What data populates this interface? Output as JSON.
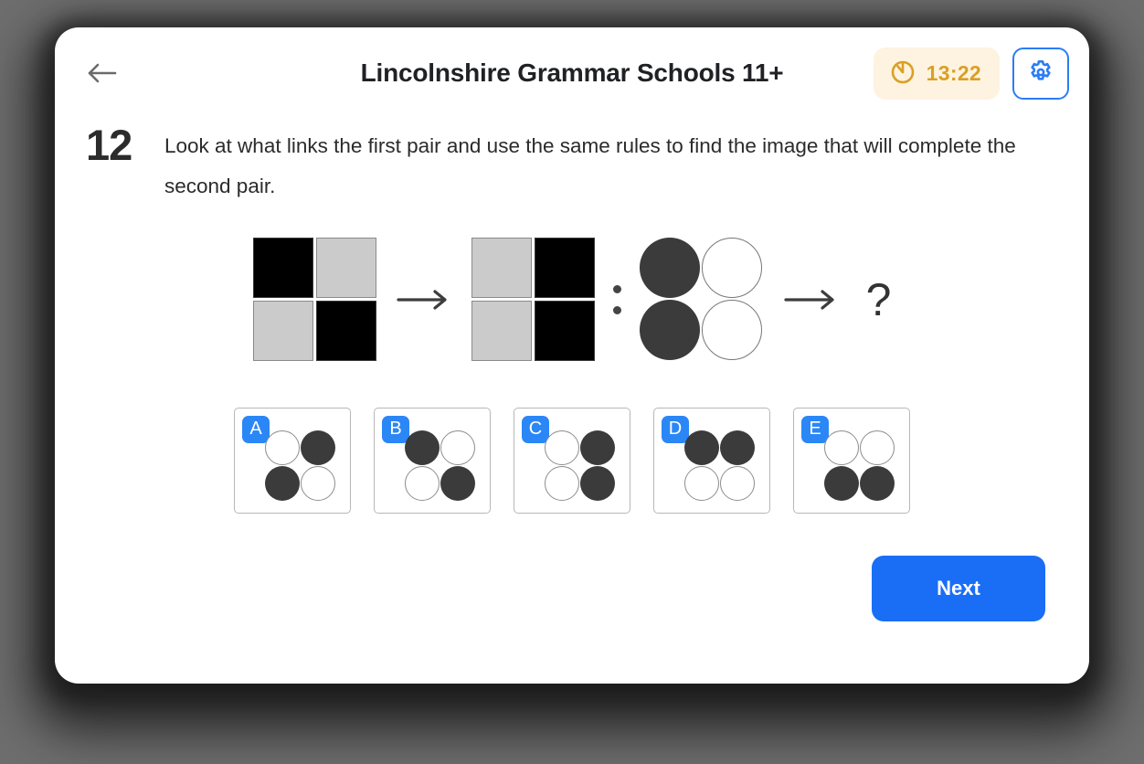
{
  "header": {
    "back_icon": "arrow-left-icon",
    "title": "Lincolnshire Grammar Schools 11+",
    "timer": {
      "icon": "stopwatch-icon",
      "value": "13:22",
      "bg": "#fdf3e0",
      "color": "#d9a024"
    },
    "settings": {
      "icon": "gear-icon",
      "border_color": "#2b7cf6"
    }
  },
  "question": {
    "number": "12",
    "text": "Look at what links the first pair and use the same rules to find the image that will complete the second pair."
  },
  "figure": {
    "first_pair": {
      "left": {
        "type": "squares",
        "cells": [
          "black",
          "gray",
          "gray",
          "black"
        ]
      },
      "arrow": "right-arrow-icon",
      "right": {
        "type": "squares",
        "cells": [
          "gray",
          "black",
          "gray",
          "black"
        ]
      }
    },
    "separator": "colon",
    "second_pair": {
      "left": {
        "type": "circles",
        "cells": [
          "dark",
          "light",
          "dark",
          "light"
        ]
      },
      "arrow": "right-arrow-icon",
      "right": {
        "type": "unknown",
        "glyph": "?"
      }
    }
  },
  "options": [
    {
      "label": "A",
      "cells": [
        "light",
        "dark",
        "dark",
        "light"
      ]
    },
    {
      "label": "B",
      "cells": [
        "dark",
        "light",
        "light",
        "dark"
      ]
    },
    {
      "label": "C",
      "cells": [
        "light",
        "dark",
        "light",
        "dark"
      ]
    },
    {
      "label": "D",
      "cells": [
        "dark",
        "dark",
        "light",
        "light"
      ]
    },
    {
      "label": "E",
      "cells": [
        "light",
        "light",
        "dark",
        "dark"
      ]
    }
  ],
  "footer": {
    "next_label": "Next",
    "next_color": "#1a6ef5"
  },
  "colors": {
    "page_bg": "#6e6e6e",
    "card_bg": "#ffffff",
    "accent_blue": "#2b87f6",
    "square_black": "#000000",
    "square_gray": "#cbcbcb",
    "circle_dark": "#3b3b3b"
  }
}
